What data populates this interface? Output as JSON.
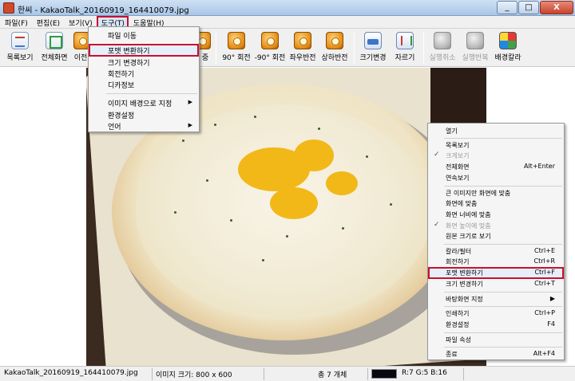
{
  "window": {
    "title": "한씨 - KakaoTalk_20160919_164410079.jpg",
    "minimize": "_",
    "maximize": "□",
    "close": "X"
  },
  "menubar": {
    "items": [
      "파일(F)",
      "편집(E)",
      "보기(V)",
      "도구(T)",
      "도움말(H)"
    ],
    "active_index": 3
  },
  "toolbar": {
    "buttons": [
      {
        "label": "목록보기",
        "icon": "list-view-icon"
      },
      {
        "label": "전체화면",
        "icon": "fullscreen-icon"
      },
      {
        "label": "이전",
        "icon": "previous-icon"
      },
      {
        "label": "중",
        "icon": "zoom-icon"
      },
      {
        "label": "90° 회전",
        "icon": "rotate-90-icon"
      },
      {
        "label": "-90° 회전",
        "icon": "rotate-minus-90-icon"
      },
      {
        "label": "좌우반전",
        "icon": "flip-horizontal-icon"
      },
      {
        "label": "상하반전",
        "icon": "flip-vertical-icon"
      },
      {
        "label": "크기변경",
        "icon": "resize-icon"
      },
      {
        "label": "자르기",
        "icon": "crop-icon"
      },
      {
        "label": "실행취소",
        "icon": "undo-icon",
        "disabled": true
      },
      {
        "label": "실행반복",
        "icon": "redo-icon",
        "disabled": true
      },
      {
        "label": "배경칼라",
        "icon": "background-color-icon"
      }
    ]
  },
  "tools_menu": {
    "items": [
      {
        "label": "파일 이동"
      },
      {
        "label": "포맷 변환하기",
        "highlighted": true
      },
      {
        "label": "크기 변경하기"
      },
      {
        "label": "회전하기"
      },
      {
        "label": "디카정보"
      },
      {
        "label": "이미지 배경으로 지정",
        "submenu": true
      },
      {
        "label": "환경설정"
      },
      {
        "label": "언어",
        "submenu": true
      }
    ]
  },
  "context_menu": {
    "items": [
      {
        "label": "열기"
      },
      {
        "label": "목록보기"
      },
      {
        "label": "크게보기",
        "disabled": true,
        "checked": true
      },
      {
        "label": "전체화면",
        "shortcut": "Alt+Enter"
      },
      {
        "label": "연속보기"
      },
      {
        "label": "큰 이미지만 화면에 맞춤"
      },
      {
        "label": "화면에 맞춤"
      },
      {
        "label": "화면 너비에 맞춤"
      },
      {
        "label": "화면 높이에 맞춤",
        "disabled": true,
        "checked": true
      },
      {
        "label": "원본 크기로 보기"
      },
      {
        "label": "칼라/필터",
        "shortcut": "Ctrl+E"
      },
      {
        "label": "회전하기",
        "shortcut": "Ctrl+R"
      },
      {
        "label": "포맷 변환하기",
        "shortcut": "Ctrl+F",
        "highlighted": true
      },
      {
        "label": "크기 변경하기",
        "shortcut": "Ctrl+T"
      },
      {
        "label": "바탕화면 지정",
        "submenu": "▶"
      },
      {
        "label": "인쇄하기",
        "shortcut": "Ctrl+P"
      },
      {
        "label": "환경설정",
        "shortcut": "F4"
      },
      {
        "label": "파일 속성"
      },
      {
        "label": "종료",
        "shortcut": "Alt+F4"
      }
    ]
  },
  "statusbar": {
    "filename": "KakaoTalk_20160919_164410079.jpg",
    "image_size": "이미지 크기: 800 x 600",
    "count": "총 7 개체",
    "pixel_color": "R:7 G:5 B:16",
    "swatch_color": "#070810"
  },
  "colors": {
    "highlight_outline": "#c8102e",
    "menu_bg": "#f5f5f5",
    "titlebar": "#a9c6e8"
  }
}
